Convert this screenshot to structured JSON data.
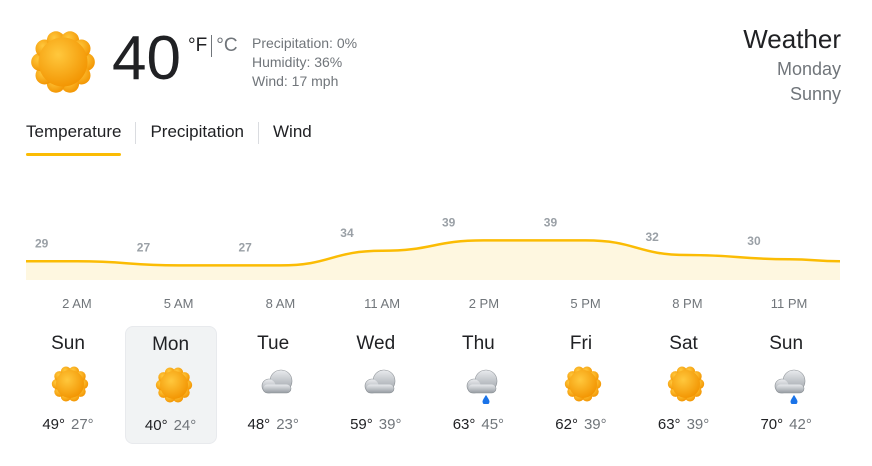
{
  "current": {
    "temperature": "40",
    "unit_f": "°F",
    "unit_c": "°C",
    "precipitation": "Precipitation: 0%",
    "humidity": "Humidity: 36%",
    "wind": "Wind: 17 mph",
    "icon": "sun-icon"
  },
  "header": {
    "title": "Weather",
    "day": "Monday",
    "condition": "Sunny"
  },
  "tabs": [
    {
      "label": "Temperature",
      "active": true
    },
    {
      "label": "Precipitation",
      "active": false
    },
    {
      "label": "Wind",
      "active": false
    }
  ],
  "chart_data": {
    "type": "area",
    "x": [
      "2 AM",
      "5 AM",
      "8 AM",
      "11 AM",
      "2 PM",
      "5 PM",
      "8 PM",
      "11 PM"
    ],
    "values": [
      29,
      27,
      27,
      34,
      39,
      39,
      32,
      30
    ],
    "color": "#fbbc04",
    "fill": "#fef7e0"
  },
  "forecast": [
    {
      "day": "Sun",
      "high": "49°",
      "low": "27°",
      "icon": "sun-icon"
    },
    {
      "day": "Mon",
      "high": "40°",
      "low": "24°",
      "icon": "sun-icon",
      "selected": true
    },
    {
      "day": "Tue",
      "high": "48°",
      "low": "23°",
      "icon": "cloud-icon"
    },
    {
      "day": "Wed",
      "high": "59°",
      "low": "39°",
      "icon": "cloud-icon"
    },
    {
      "day": "Thu",
      "high": "63°",
      "low": "45°",
      "icon": "rain-cloud-icon"
    },
    {
      "day": "Fri",
      "high": "62°",
      "low": "39°",
      "icon": "sun-icon"
    },
    {
      "day": "Sat",
      "high": "63°",
      "low": "39°",
      "icon": "sun-icon"
    },
    {
      "day": "Sun",
      "high": "70°",
      "low": "42°",
      "icon": "rain-cloud-icon"
    }
  ]
}
